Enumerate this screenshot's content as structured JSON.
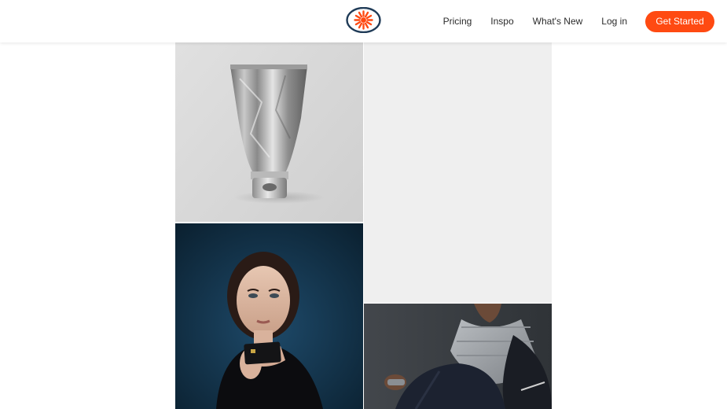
{
  "header": {
    "logo_icon": "sunburst-logo-icon",
    "nav": [
      {
        "label": "Pricing"
      },
      {
        "label": "Inspo"
      },
      {
        "label": "What's New"
      },
      {
        "label": "Log in"
      }
    ],
    "cta_label": "Get Started"
  },
  "colors": {
    "accent": "#ff4a12",
    "logo_ring": "#1f3b57",
    "logo_sun": "#ff4a12",
    "placeholder_tile": "#efefef"
  },
  "gallery": {
    "tiles": [
      {
        "subject": "silver-squeeze-tube"
      },
      {
        "subject": "blank-loading-tile"
      },
      {
        "subject": "woman-holding-card"
      },
      {
        "subject": "man-in-grey-puffer-vest"
      }
    ]
  }
}
